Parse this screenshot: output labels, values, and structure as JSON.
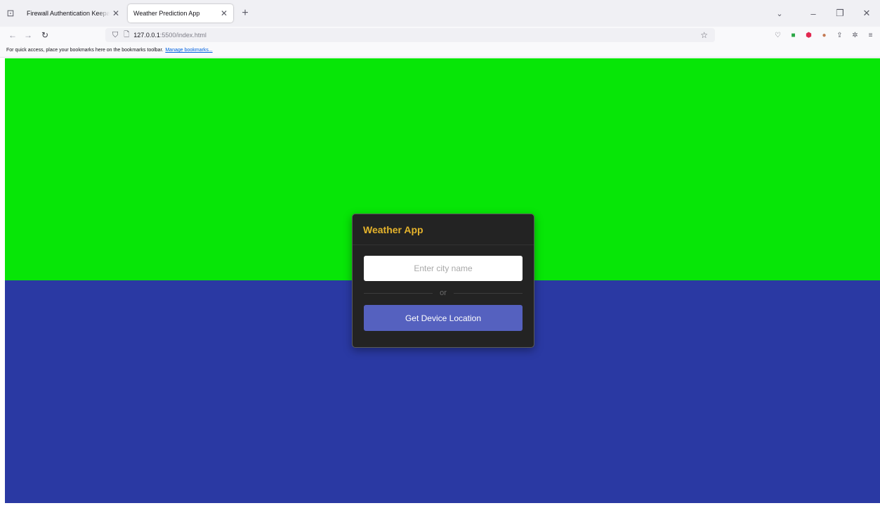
{
  "browser": {
    "tabs": [
      {
        "title": "Firewall Authentication Keepalive Window",
        "active": false
      },
      {
        "title": "Weather Prediction App",
        "active": true
      }
    ],
    "url_host": "127.0.0.1",
    "url_rest": ":5500/index.html",
    "bookmarks_text": "For quick access, place your bookmarks here on the bookmarks toolbar.",
    "bookmarks_link": "Manage bookmarks..."
  },
  "app": {
    "title": "Weather App",
    "city_placeholder": "Enter city name",
    "separator": "or",
    "location_button": "Get Device Location"
  },
  "colors": {
    "bg_top": "#07e607",
    "bg_bottom": "#2a39a3",
    "card": "#232323",
    "title_accent": "#e5b32c",
    "button": "#5561bf"
  },
  "icons": {
    "tab_list": "tab-list-icon",
    "back": "back-arrow-icon",
    "forward": "forward-arrow-icon",
    "reload": "reload-icon",
    "shield": "tracking-shield-icon",
    "page": "page-icon",
    "bookmark_star": "bookmark-star-icon"
  }
}
